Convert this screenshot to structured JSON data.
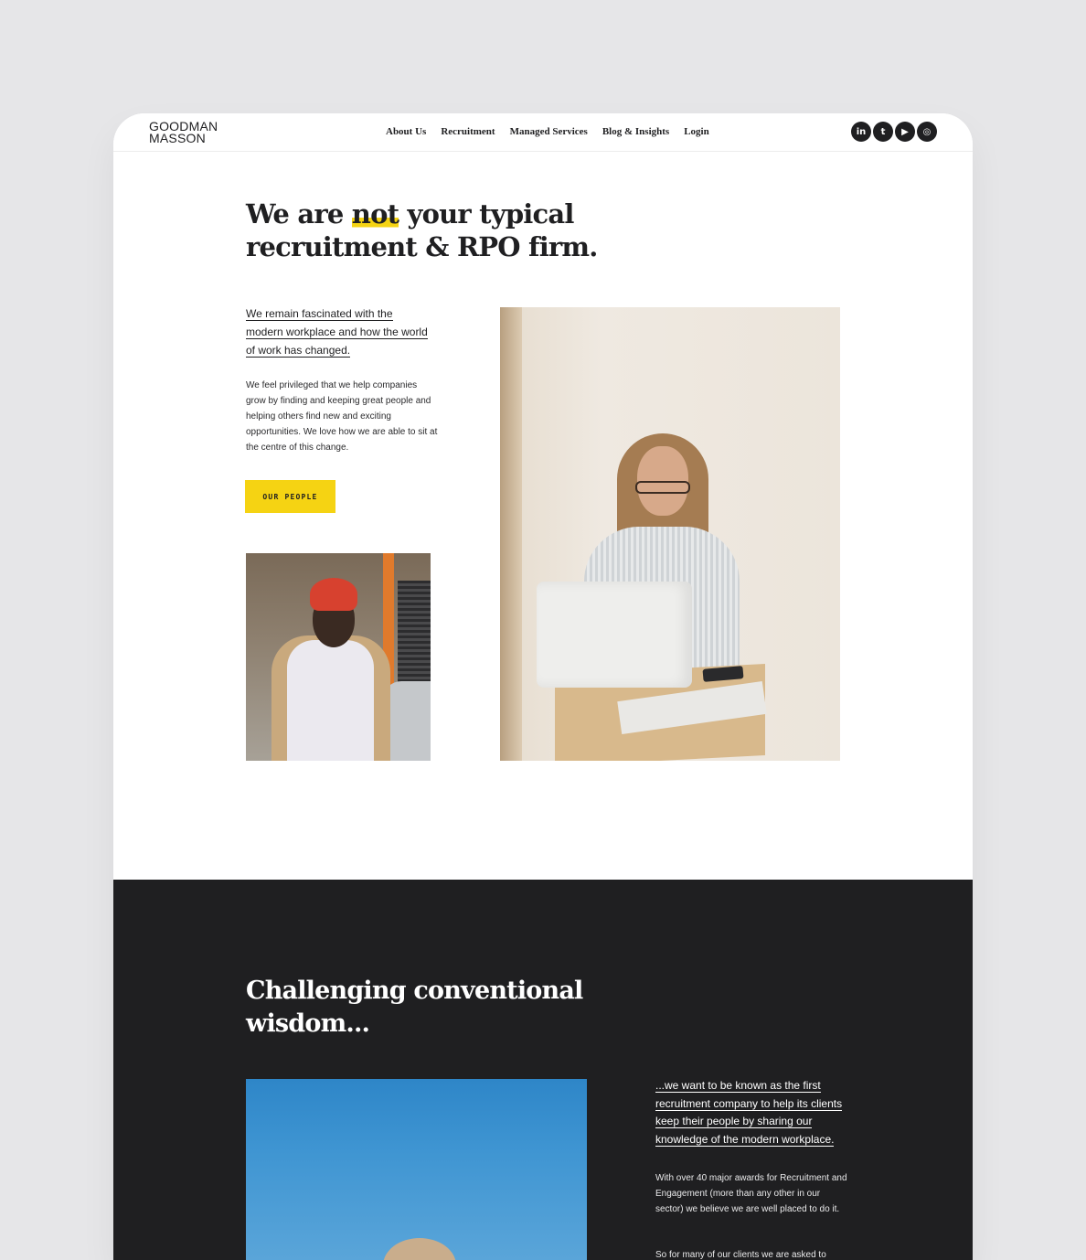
{
  "brand": {
    "logo_line1": "GOODMAN",
    "logo_line2": "MASSON"
  },
  "nav": {
    "items": [
      {
        "label": "About Us"
      },
      {
        "label": "Recruitment"
      },
      {
        "label": "Managed Services"
      },
      {
        "label": "Blog & Insights"
      },
      {
        "label": "Login"
      }
    ]
  },
  "socials": {
    "items": [
      {
        "icon": "linkedin-icon",
        "glyph": "in"
      },
      {
        "icon": "twitter-icon",
        "glyph": "t"
      },
      {
        "icon": "youtube-icon",
        "glyph": "▶"
      },
      {
        "icon": "instagram-icon",
        "glyph": "◎"
      }
    ]
  },
  "hero": {
    "title_pre": "We are ",
    "title_highlight": "not",
    "title_post": " your typical recruitment & RPO firm.",
    "intro": "We remain fascinated with the modern workplace and how the world of work has changed.",
    "body": "We feel privileged that we help companies grow by finding and keeping great people and helping others find new and exciting opportunities. We love how we are able to sit at the centre of this change.",
    "cta_label": "OUR PEOPLE"
  },
  "dark_section": {
    "title": "Challenging conventional wisdom...",
    "intro": "...we want to be known as the first recruitment company to help its clients keep their people by sharing our knowledge of the modern workplace.",
    "body": "With over 40 major awards for Recruitment and Engagement (more than any other in our sector) we believe we are well placed to do it.",
    "body2": "So for many of our clients we are asked to"
  },
  "colors": {
    "accent": "#f5d313",
    "dark_bg": "#1f1f21",
    "page_bg": "#e6e6e8",
    "text": "#1f1f21"
  }
}
